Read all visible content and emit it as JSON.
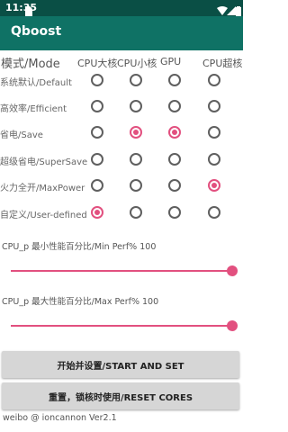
{
  "status_bar": {
    "time": "11:35",
    "icons": [
      "sim-icon",
      "wifi-icon",
      "signal-icon",
      "battery-icon"
    ]
  },
  "app_bar": {
    "title": "Qboost"
  },
  "grid": {
    "header": "模式/Mode",
    "columns": [
      "CPU大核",
      "CPU小核",
      "GPU",
      "CPU超核"
    ],
    "rows": [
      {
        "label": "系统默认/Default",
        "selected": [
          false,
          false,
          false,
          false
        ]
      },
      {
        "label": "高效率/Efficient",
        "selected": [
          false,
          false,
          false,
          false
        ]
      },
      {
        "label": "省电/Save",
        "selected": [
          false,
          true,
          true,
          false
        ]
      },
      {
        "label": "超级省电/SuperSave",
        "selected": [
          false,
          false,
          false,
          false
        ]
      },
      {
        "label": "火力全开/MaxPower",
        "selected": [
          false,
          false,
          false,
          true
        ]
      },
      {
        "label": "自定义/User-defined",
        "selected": [
          true,
          false,
          false,
          false
        ]
      }
    ]
  },
  "min_perf": {
    "label": "CPU_p 最小性能百分比/Min Perf% 100",
    "value": 100
  },
  "max_perf": {
    "label": "CPU_p 最大性能百分比/Max Perf% 100",
    "value": 100
  },
  "buttons": {
    "start": "开始并设置/START AND SET",
    "reset": "重置，锁核时使用/RESET CORES"
  },
  "footer": "weibo @ ioncannon Ver2.1",
  "colors": {
    "status_bar": "#0a4f45",
    "app_bar": "#0f7265",
    "accent": "#e2507f",
    "button": "#d6d6d6"
  }
}
